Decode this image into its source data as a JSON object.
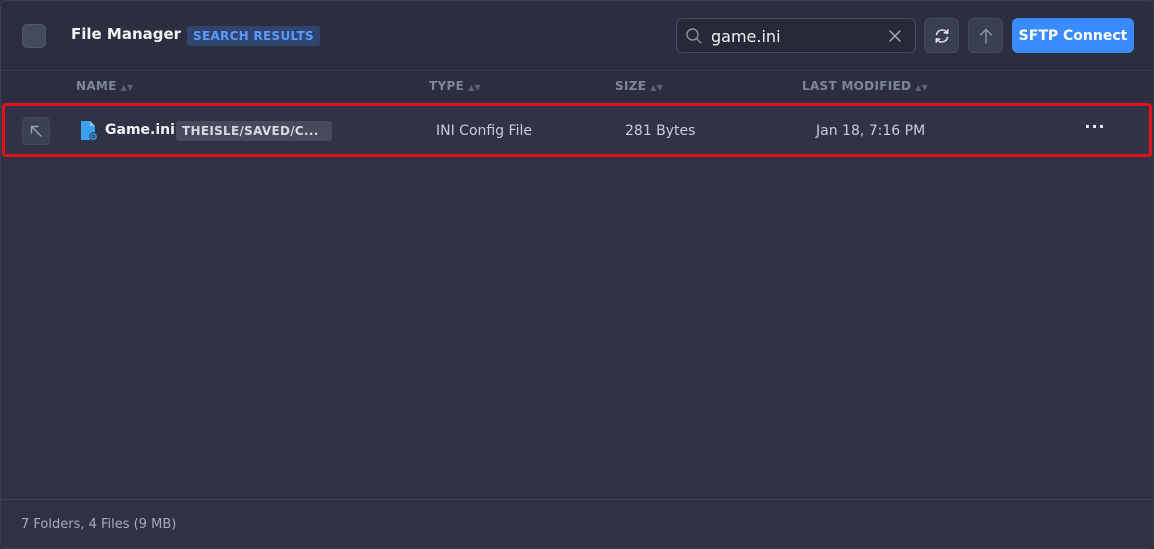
{
  "header": {
    "title": "File Manager",
    "badge": "SEARCH RESULTS",
    "search": {
      "value": "game.ini",
      "placeholder": ""
    },
    "sftp_label": "SFTP Connect"
  },
  "columns": {
    "name": "NAME",
    "type": "TYPE",
    "size": "SIZE",
    "modified": "LAST MODIFIED"
  },
  "rows": [
    {
      "name": "Game.ini",
      "path": "THEISLE/SAVED/C...",
      "type": "INI Config File",
      "size": "281 Bytes",
      "modified": "Jan 18, 7:16 PM",
      "icon": "config-file-icon"
    }
  ],
  "footer": {
    "summary": "7 Folders, 4 Files (9 MB)"
  },
  "colors": {
    "accent": "#3a8bff",
    "badge_text": "#5b9bff",
    "highlight_border": "#e5101c",
    "file_icon": "#3aa0f0"
  }
}
